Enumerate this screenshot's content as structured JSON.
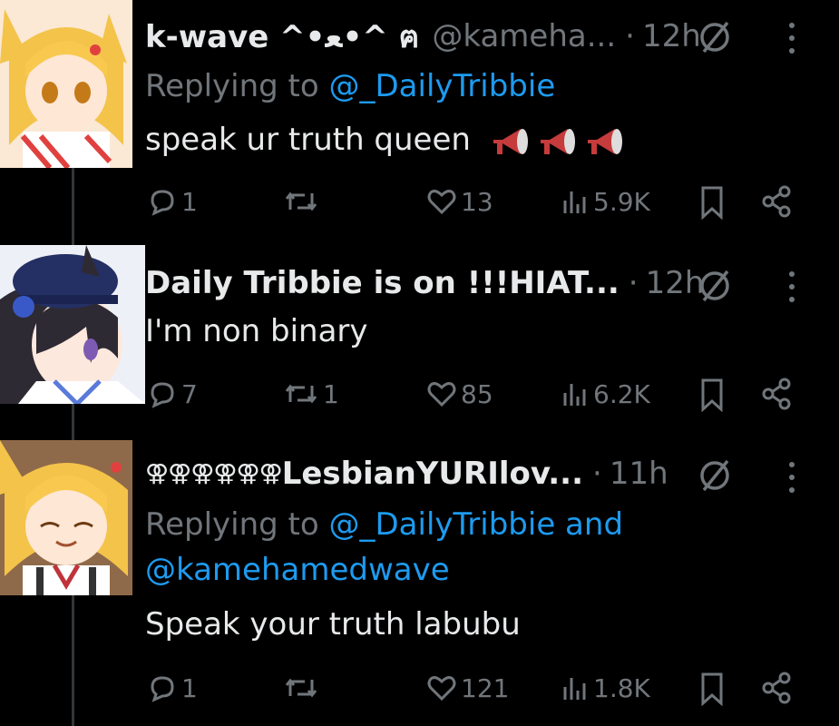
{
  "tweets": [
    {
      "name": "k-wave ^•ﻌ•^ ฅ",
      "handle": "@kameha...",
      "time": "12h",
      "reply_prefix": "Replying to ",
      "reply_mention": "@_DailyTribbie",
      "text": "speak ur truth queen",
      "text_emoji": "loudspeaker-emoji x3",
      "replies": "1",
      "reposts": "",
      "likes": "13",
      "views": "5.9K"
    },
    {
      "name": "Daily Tribbie is on !!!HIAT...",
      "time": "12h",
      "text": "I'm non binary",
      "replies": "7",
      "reposts": "1",
      "likes": "85",
      "views": "6.2K"
    },
    {
      "name_symbols": "⚢⚢⚢⚢⚢⚢",
      "name": "LesbianYURIlov...",
      "time": "11h",
      "reply_prefix": "Replying to ",
      "reply_mention": "@_DailyTribbie and",
      "reply_mention2": "@kamehamedwave",
      "text": "Speak your truth labubu",
      "replies": "1",
      "reposts": "",
      "likes": "121",
      "views": "1.8K"
    }
  ],
  "separator": "·",
  "colors": {
    "background": "#000000",
    "text": "#e7e9ea",
    "muted": "#71767b",
    "link": "#1d9bf0"
  }
}
